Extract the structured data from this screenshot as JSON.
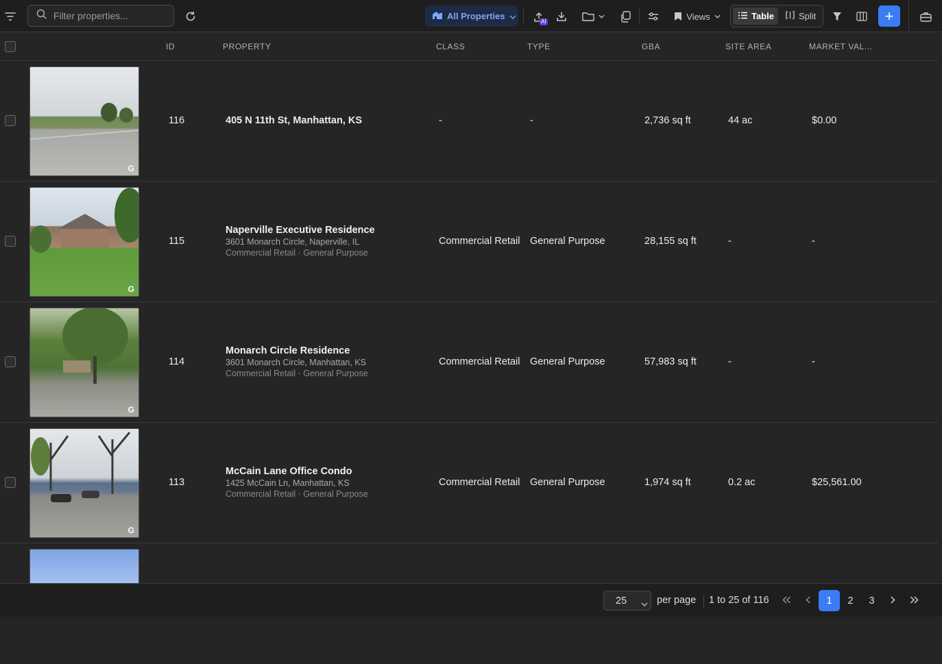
{
  "toolbar": {
    "search_placeholder": "Filter properties...",
    "all_properties_label": "All Properties",
    "ai_badge": "AI",
    "views_label": "Views",
    "table_label": "Table",
    "split_label": "Split",
    "accent_color": "#3b7cf6"
  },
  "columns": [
    "ID",
    "PROPERTY",
    "CLASS",
    "TYPE",
    "GBA",
    "SITE AREA",
    "MARKET VAL..."
  ],
  "rows": [
    {
      "id": "116",
      "name": "405 N 11th St, Manhattan, KS",
      "address": "",
      "meta": "",
      "class": "-",
      "type": "-",
      "gba": "2,736 sq ft",
      "site_area": "44 ac",
      "market_value": "$0.00",
      "photo_mark": "G"
    },
    {
      "id": "115",
      "name": "Naperville Executive Residence",
      "address": "3601 Monarch Circle, Naperville, IL",
      "meta": "Commercial Retail · General Purpose",
      "class": "Commercial Retail",
      "type": "General Purpose",
      "gba": "28,155 sq ft",
      "site_area": "-",
      "market_value": "-",
      "photo_mark": "G"
    },
    {
      "id": "114",
      "name": "Monarch Circle Residence",
      "address": "3601 Monarch Circle, Manhattan, KS",
      "meta": "Commercial Retail · General Purpose",
      "class": "Commercial Retail",
      "type": "General Purpose",
      "gba": "57,983 sq ft",
      "site_area": "-",
      "market_value": "-",
      "photo_mark": "G"
    },
    {
      "id": "113",
      "name": "McCain Lane Office Condo",
      "address": "1425 McCain Ln, Manhattan, KS",
      "meta": "Commercial Retail · General Purpose",
      "class": "Commercial Retail",
      "type": "General Purpose",
      "gba": "1,974 sq ft",
      "site_area": "0.2 ac",
      "market_value": "$25,561.00",
      "photo_mark": "G"
    }
  ],
  "footer": {
    "page_size": "25",
    "per_page_label": "per page",
    "range_text": "1 to 25 of 116",
    "pages": [
      "1",
      "2",
      "3"
    ],
    "current_page": "1"
  }
}
